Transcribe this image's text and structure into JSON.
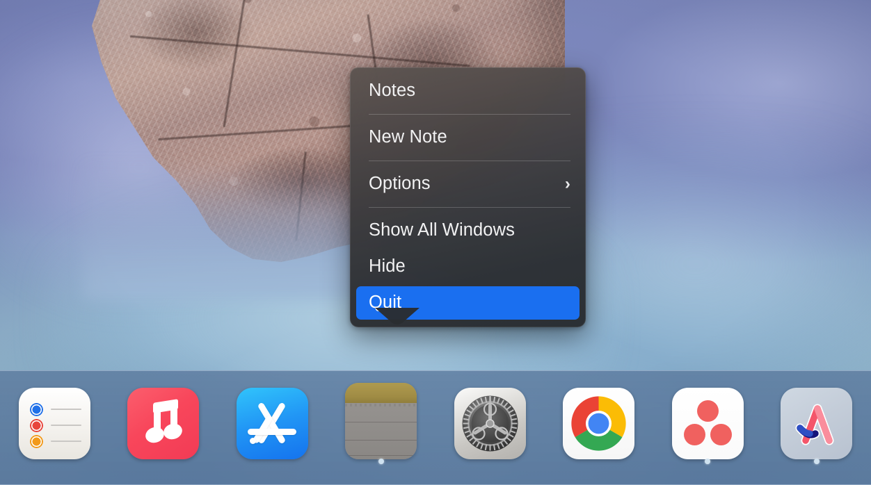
{
  "desktop": {
    "os": "macOS",
    "wallpaper_name": "rocky-shore-blue-mist",
    "wallpaper_colors": {
      "water": "#8fb0cc",
      "mist": "#9ec8da",
      "rock_light": "#c9b4ac",
      "rock_dark": "#4a3633"
    }
  },
  "context_menu": {
    "name": "dock-app-context-menu",
    "app": "Notes",
    "accent_color": "#1a6ff0",
    "background_color": "#3a3c40",
    "text_color": "#f2f2f3",
    "items": [
      {
        "label": "Notes",
        "type": "item",
        "selected": false,
        "has_submenu": false
      },
      {
        "label": "New Note",
        "type": "item",
        "selected": false,
        "has_submenu": false
      },
      {
        "label": "Options",
        "type": "item",
        "selected": false,
        "has_submenu": true,
        "submenu_icon": "chevron-right-icon"
      },
      {
        "label": "Show All Windows",
        "type": "item",
        "selected": false,
        "has_submenu": false
      },
      {
        "label": "Hide",
        "type": "item",
        "selected": false,
        "has_submenu": false
      },
      {
        "label": "Quit",
        "type": "item",
        "selected": true,
        "has_submenu": false
      }
    ],
    "separators_after": [
      0,
      1,
      2
    ]
  },
  "dock": {
    "name": "macos-dock",
    "background_color": "#5c7a9e",
    "running_indicator_color": "#cfe2f0",
    "items": [
      {
        "name": "Reminders",
        "icon": "reminders-icon",
        "running": false
      },
      {
        "name": "Music",
        "icon": "music-icon",
        "running": false
      },
      {
        "name": "App Store",
        "icon": "app-store-icon",
        "running": false
      },
      {
        "name": "Notes",
        "icon": "notes-icon",
        "running": true
      },
      {
        "name": "System Settings",
        "icon": "settings-icon",
        "running": false
      },
      {
        "name": "Google Chrome",
        "icon": "chrome-icon",
        "running": false
      },
      {
        "name": "Asana",
        "icon": "asana-icon",
        "running": true
      },
      {
        "name": "Arc",
        "icon": "arc-icon",
        "running": true
      }
    ]
  },
  "icon_colors": {
    "reminders_blue": "#2070e8",
    "reminders_red": "#e8453c",
    "reminders_orange": "#f29a1a",
    "music_red": "#f8465b",
    "appstore_blue": "#2196f5",
    "notes_yellow": "#b08c0a",
    "chrome_red": "#ea4335",
    "chrome_yellow": "#fbbc05",
    "chrome_green": "#34a853",
    "chrome_blue": "#4285f4",
    "asana_coral": "#f0615f",
    "arc_pink": "#f4566a",
    "arc_navy": "#16147a"
  }
}
